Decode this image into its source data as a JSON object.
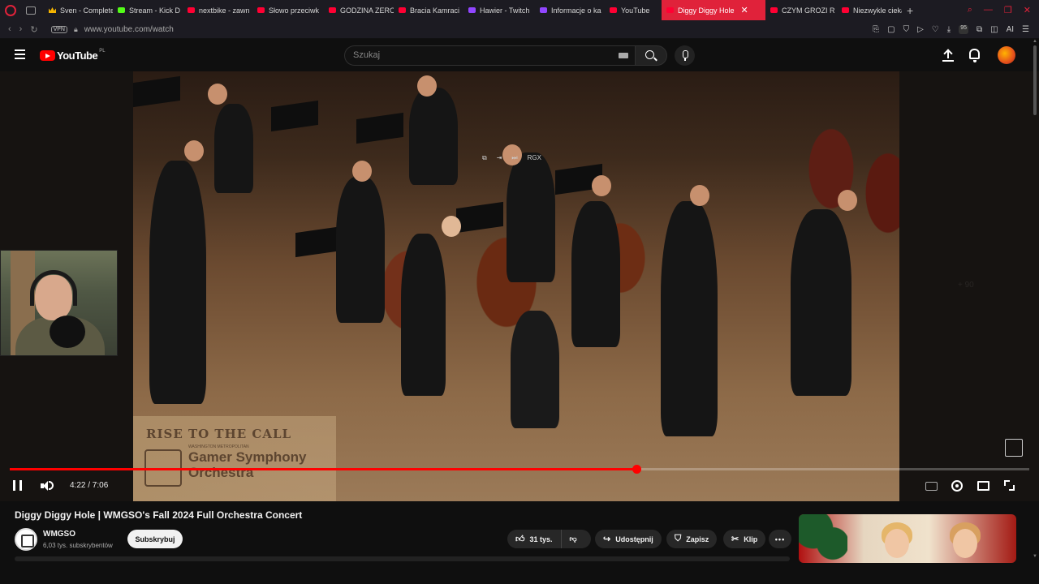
{
  "browser": {
    "tabs": [
      {
        "label": "Sven - Complete",
        "favicon": "crown-icon",
        "active": false
      },
      {
        "label": "Stream - Kick D",
        "favicon": "kick-icon",
        "active": false
      },
      {
        "label": "nextbike - zawn",
        "favicon": "youtube-icon",
        "active": false
      },
      {
        "label": "Słowo przeciwk",
        "favicon": "youtube-icon",
        "active": false
      },
      {
        "label": "GODZINA ZERO",
        "favicon": "youtube-icon",
        "active": false
      },
      {
        "label": "Bracia Kamraci",
        "favicon": "youtube-icon",
        "active": false
      },
      {
        "label": "Hawier - Twitch",
        "favicon": "twitch-icon",
        "active": false
      },
      {
        "label": "Informacje o ka",
        "favicon": "twitch-icon",
        "active": false
      },
      {
        "label": "YouTube",
        "favicon": "youtube-icon",
        "active": false
      },
      {
        "label": "Diggy Diggy Hole",
        "favicon": "youtube-icon",
        "active": true
      },
      {
        "label": "CZYM GROZI R",
        "favicon": "youtube-icon",
        "active": false
      },
      {
        "label": "Niezwykle cieka",
        "favicon": "youtube-icon",
        "active": false
      }
    ],
    "new_tab": "+",
    "vpn_label": "VPN",
    "url": "www.youtube.com/watch",
    "ai_label": "AI",
    "ext_badge": "95"
  },
  "youtube": {
    "logo_text": "YouTube",
    "region": "PL",
    "search_placeholder": "Szukaj"
  },
  "player": {
    "current_time": "4:22",
    "duration": "7:06",
    "time_display": "4:22 / 7:06",
    "progress_fraction": 0.615,
    "overlay_logo_line1": "RISE TO THE CALL",
    "overlay_logo_line2": "Gamer Symphony",
    "overlay_logo_line3": "Orchestra",
    "overlay_logo_small": "WASHINGTON METROPOLITAN",
    "overlay_top_text": "RGX",
    "faint_right_text": "+ 90",
    "state": "playing"
  },
  "video": {
    "title": "Diggy Diggy Hole | WMGSO's Fall 2024 Full Orchestra Concert",
    "channel_name": "WMGSO",
    "subscribers": "6,03 tys. subskrybentów",
    "subscribe_label": "Subskrybuj",
    "likes": "31 tys.",
    "share_label": "Udostępnij",
    "save_label": "Zapisz",
    "clip_label": "Klip",
    "more_label": "•••"
  },
  "colors": {
    "accent": "#ff0000",
    "opera_red": "#e0223a",
    "background": "#0f0f0f"
  }
}
